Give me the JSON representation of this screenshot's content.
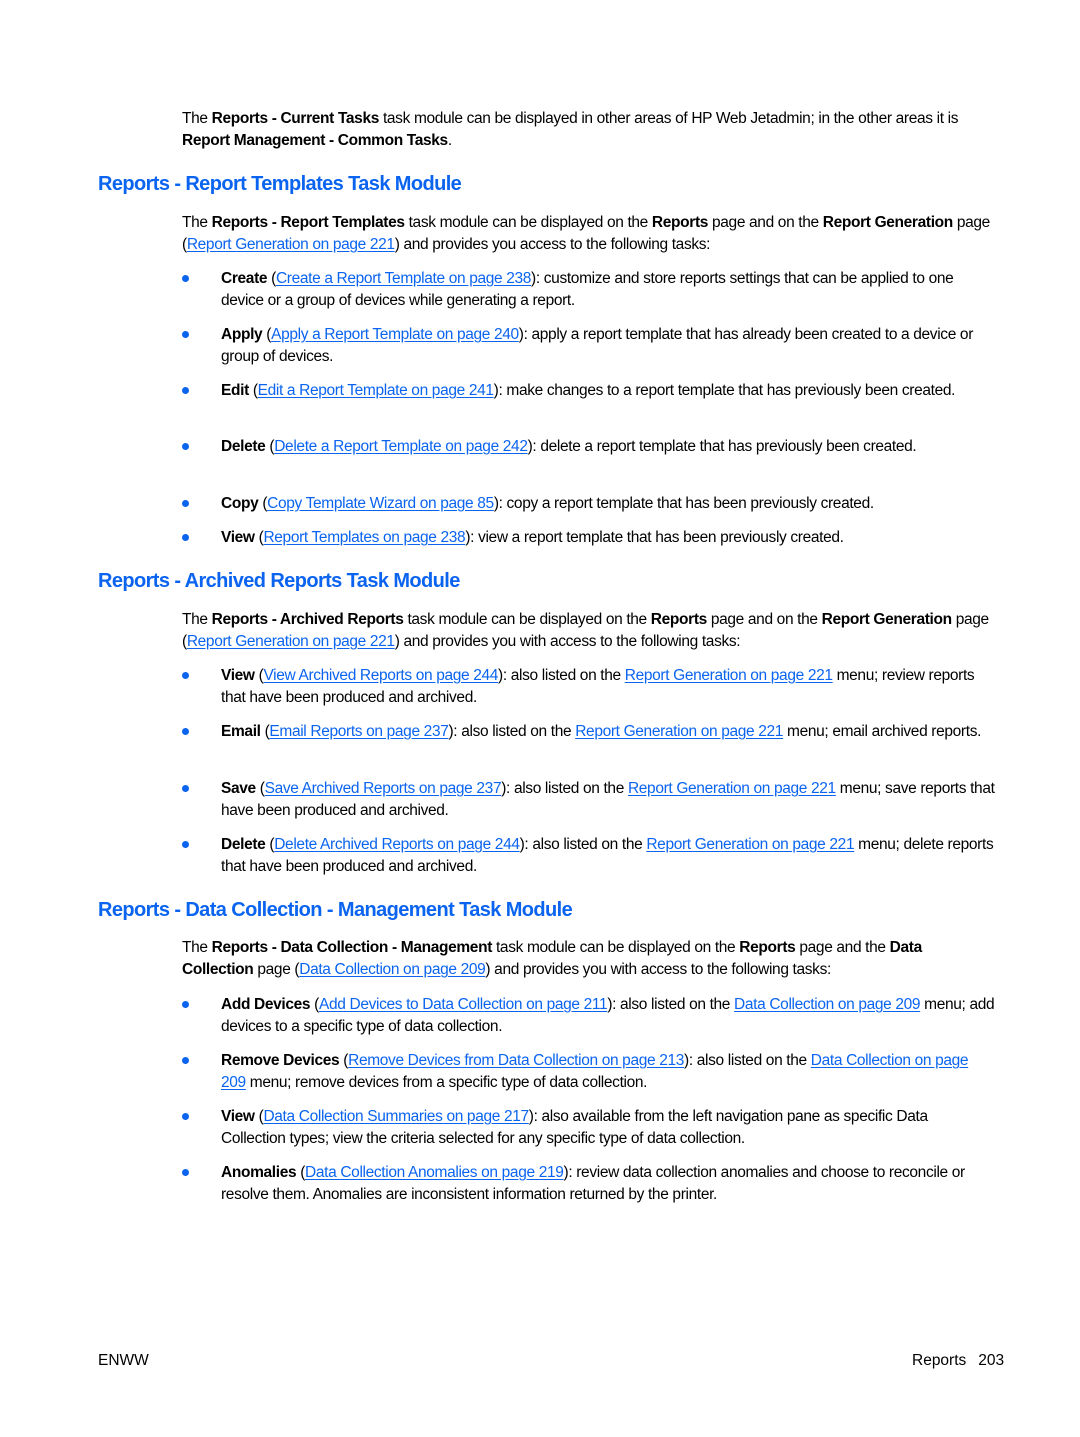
{
  "colors": {
    "heading": "#0a64f0",
    "link": "#0a64f0",
    "bullet": "#0a64f0",
    "text": "#000000"
  },
  "intro": {
    "t1": "The ",
    "b1": "Reports - Current Tasks",
    "t2": " task module can be displayed in other areas of HP Web Jetadmin; in the other areas it is ",
    "b2": "Report Management - Common Tasks",
    "t3": "."
  },
  "sections": [
    {
      "heading": "Reports - Report Templates Task Module",
      "intro": {
        "t1": "The ",
        "b1": "Reports - Report Templates",
        "t2": " task module can be displayed on the ",
        "b2": "Reports",
        "t3": " page and on the ",
        "b3": "Report Generation",
        "t4": " page (",
        "link": "Report Generation on page 221",
        "t5": ") and provides you access to the following tasks:"
      },
      "items": [
        {
          "label": "Create",
          "link": "Create a Report Template on page 238",
          "text": "): customize and store reports settings that can be applied to one device or a group of devices while generating a report."
        },
        {
          "label": "Apply",
          "link": "Apply a Report Template on page 240",
          "text": "): apply a report template that has already been created to a device or group of devices."
        },
        {
          "label": "Edit",
          "link": "Edit a Report Template on page 241",
          "text": "): make changes to a report template that has previously been created."
        },
        {
          "label": "Delete",
          "link": "Delete a Report Template on page 242",
          "text": "): delete a report template that has previously been created."
        },
        {
          "label": "Copy",
          "link": "Copy Template Wizard on page 85",
          "text": "): copy a report template that has been previously created."
        },
        {
          "label": "View",
          "link": "Report Templates on page 238",
          "text": "): view a report template that has been previously created."
        }
      ]
    },
    {
      "heading": "Reports - Archived Reports Task Module",
      "intro": {
        "t1": "The ",
        "b1": "Reports - Archived Reports",
        "t2": " task module can be displayed on the ",
        "b2": "Reports",
        "t3": " page and on the ",
        "b3": "Report Generation",
        "t4": " page (",
        "link": "Report Generation on page 221",
        "t5": ") and provides you with access to the following tasks:"
      },
      "items": [
        {
          "label": "View",
          "link": "View Archived Reports on page 244",
          "mid": "): also listed on the ",
          "link2": "Report Generation on page 221",
          "text": " menu; review reports that have been produced and archived."
        },
        {
          "label": "Email",
          "link": "Email Reports on page 237",
          "mid": "): also listed on the ",
          "link2": "Report Generation on page 221",
          "text": " menu; email archived reports."
        },
        {
          "label": "Save",
          "link": "Save Archived Reports on page 237",
          "mid": "): also listed on the ",
          "link2": "Report Generation on page 221",
          "text": " menu; save reports that have been produced and archived."
        },
        {
          "label": "Delete",
          "link": "Delete Archived Reports on page 244",
          "mid": "): also listed on the ",
          "link2": "Report Generation on page 221",
          "text": " menu; delete reports that have been produced and archived."
        }
      ]
    },
    {
      "heading": "Reports - Data Collection - Management Task Module",
      "intro": {
        "t1": "The ",
        "b1": "Reports - Data Collection - Management",
        "t2": " task module can be displayed on the ",
        "b2": "Reports",
        "t3": " page and the ",
        "b3": "Data Collection",
        "t4": " page (",
        "link": "Data Collection on page 209",
        "t5": ") and provides you with access to the following tasks:"
      },
      "items": [
        {
          "label": "Add Devices",
          "link": "Add Devices to Data Collection on page 211",
          "mid": "): also listed on the ",
          "link2": "Data Collection on page 209",
          "text": " menu; add devices to a specific type of data collection."
        },
        {
          "label": "Remove Devices",
          "link": "Remove Devices from Data Collection on page 213",
          "mid": "): also listed on the ",
          "link2": "Data Collection on page 209",
          "text": " menu; remove devices from a specific type of data collection."
        },
        {
          "label": "View",
          "link": "Data Collection Summaries on page 217",
          "text": "): also available from the left navigation pane as specific Data Collection types; view the criteria selected for any specific type of data collection."
        },
        {
          "label": "Anomalies",
          "link": "Data Collection Anomalies on page 219",
          "text": "): review data collection anomalies and choose to reconcile or resolve them. Anomalies are inconsistent information returned by the printer."
        }
      ]
    }
  ],
  "footer": {
    "left": "ENWW",
    "section": "Reports",
    "page_number": "203"
  }
}
